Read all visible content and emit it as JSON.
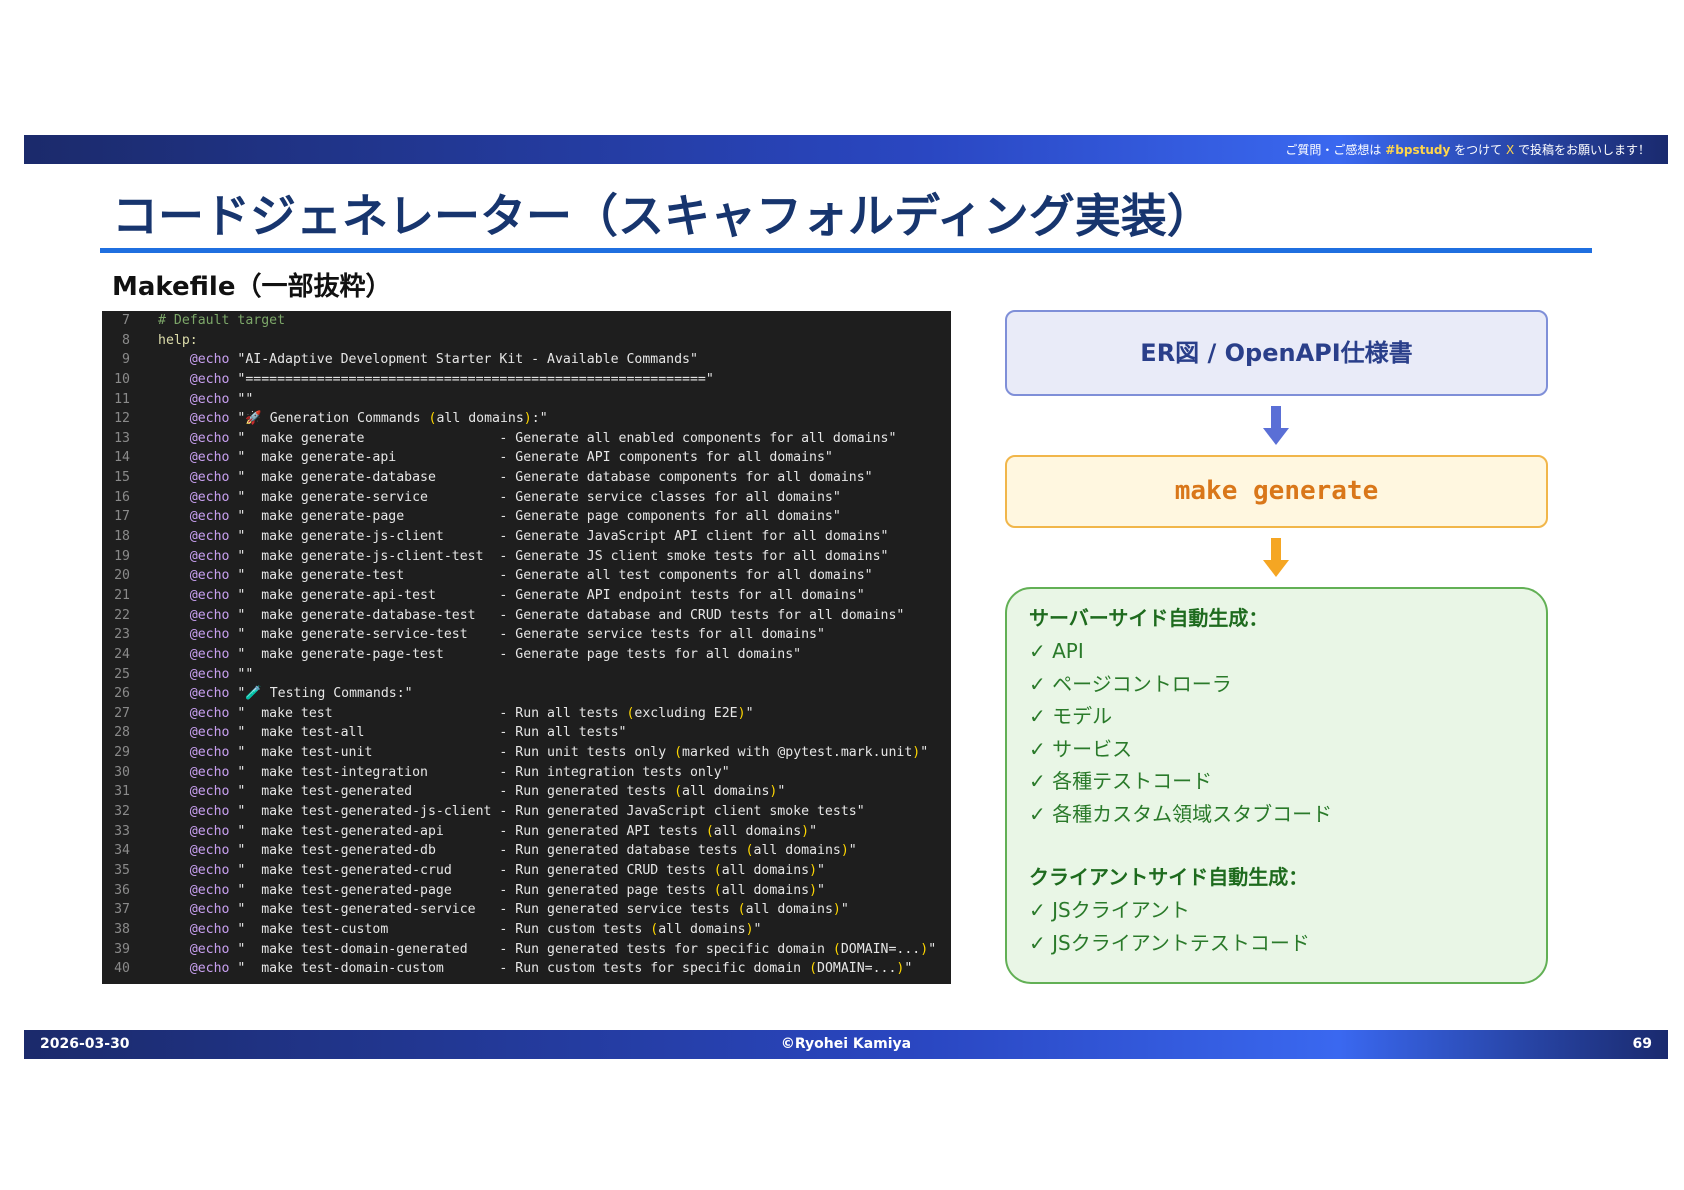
{
  "header": {
    "notice_pre": "ご質問・ご感想は ",
    "hashtag": "#bpstudy",
    "notice_mid": " をつけて ",
    "x_label": "X",
    "notice_post": " で投稿をお願いします！"
  },
  "slide": {
    "title": "コードジェネレーター（スキャフォルディング実装）",
    "section_label": "Makefile（一部抜粋）"
  },
  "code": {
    "lines": [
      {
        "no": "7",
        "text": "# Default target"
      },
      {
        "no": "8",
        "text": "help:"
      },
      {
        "no": "9",
        "text": "    @echo \"AI-Adaptive Development Starter Kit - Available Commands\""
      },
      {
        "no": "10",
        "text": "    @echo \"==========================================================\""
      },
      {
        "no": "11",
        "text": "    @echo \"\""
      },
      {
        "no": "12",
        "text": "    @echo \"🚀 Generation Commands (all domains):\""
      },
      {
        "no": "13",
        "text": "    @echo \"  make generate                 - Generate all enabled components for all domains\""
      },
      {
        "no": "14",
        "text": "    @echo \"  make generate-api             - Generate API components for all domains\""
      },
      {
        "no": "15",
        "text": "    @echo \"  make generate-database        - Generate database components for all domains\""
      },
      {
        "no": "16",
        "text": "    @echo \"  make generate-service         - Generate service classes for all domains\""
      },
      {
        "no": "17",
        "text": "    @echo \"  make generate-page            - Generate page components for all domains\""
      },
      {
        "no": "18",
        "text": "    @echo \"  make generate-js-client       - Generate JavaScript API client for all domains\""
      },
      {
        "no": "19",
        "text": "    @echo \"  make generate-js-client-test  - Generate JS client smoke tests for all domains\""
      },
      {
        "no": "20",
        "text": "    @echo \"  make generate-test            - Generate all test components for all domains\""
      },
      {
        "no": "21",
        "text": "    @echo \"  make generate-api-test        - Generate API endpoint tests for all domains\""
      },
      {
        "no": "22",
        "text": "    @echo \"  make generate-database-test   - Generate database and CRUD tests for all domains\""
      },
      {
        "no": "23",
        "text": "    @echo \"  make generate-service-test    - Generate service tests for all domains\""
      },
      {
        "no": "24",
        "text": "    @echo \"  make generate-page-test       - Generate page tests for all domains\""
      },
      {
        "no": "25",
        "text": "    @echo \"\""
      },
      {
        "no": "26",
        "text": "    @echo \"🧪 Testing Commands:\""
      },
      {
        "no": "27",
        "text": "    @echo \"  make test                     - Run all tests (excluding E2E)\""
      },
      {
        "no": "28",
        "text": "    @echo \"  make test-all                 - Run all tests\""
      },
      {
        "no": "29",
        "text": "    @echo \"  make test-unit                - Run unit tests only (marked with @pytest.mark.unit)\""
      },
      {
        "no": "30",
        "text": "    @echo \"  make test-integration         - Run integration tests only\""
      },
      {
        "no": "31",
        "text": "    @echo \"  make test-generated           - Run generated tests (all domains)\""
      },
      {
        "no": "32",
        "text": "    @echo \"  make test-generated-js-client - Run generated JavaScript client smoke tests\""
      },
      {
        "no": "33",
        "text": "    @echo \"  make test-generated-api       - Run generated API tests (all domains)\""
      },
      {
        "no": "34",
        "text": "    @echo \"  make test-generated-db        - Run generated database tests (all domains)\""
      },
      {
        "no": "35",
        "text": "    @echo \"  make test-generated-crud      - Run generated CRUD tests (all domains)\""
      },
      {
        "no": "36",
        "text": "    @echo \"  make test-generated-page      - Run generated page tests (all domains)\""
      },
      {
        "no": "37",
        "text": "    @echo \"  make test-generated-service   - Run generated service tests (all domains)\""
      },
      {
        "no": "38",
        "text": "    @echo \"  make test-custom              - Run custom tests (all domains)\""
      },
      {
        "no": "39",
        "text": "    @echo \"  make test-domain-generated    - Run generated tests for specific domain (DOMAIN=...)\""
      },
      {
        "no": "40",
        "text": "    @echo \"  make test-domain-custom       - Run custom tests for specific domain (DOMAIN=...)\""
      }
    ]
  },
  "flow": {
    "source_label": "ER図 / OpenAPI仕様書",
    "command_label": "make generate",
    "server_heading": "サーバーサイド自動生成：",
    "server_items": [
      "✓ API",
      "✓ ページコントローラ",
      "✓ モデル",
      "✓ サービス",
      "✓ 各種テストコード",
      "✓ 各種カスタム領域スタブコード"
    ],
    "client_heading": "クライアントサイド自動生成：",
    "client_items": [
      "✓ JSクライアント",
      "✓ JSクライアントテストコード"
    ]
  },
  "footer": {
    "date": "2026-03-30",
    "copyright": "©Ryohei Kamiya",
    "page": "69"
  },
  "colors": {
    "title": "#17356e",
    "rule": "#1f6fe0",
    "code_bg": "#1e1e1e",
    "accent_yellow": "#ffd54a",
    "flow_blue_border": "#7f8fd8",
    "flow_orange_border": "#f1b64a",
    "flow_green_border": "#62b055",
    "arrow_blue": "#5a6fd6",
    "arrow_orange": "#f5a623"
  }
}
